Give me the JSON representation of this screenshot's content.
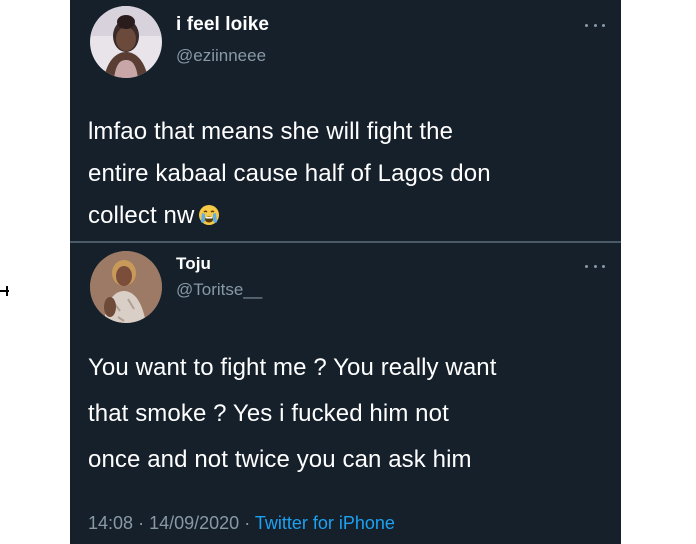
{
  "tweets": [
    {
      "display_name": "i feel loike",
      "handle": "@eziinneee",
      "text_lines": [
        "lmfao that means she will fight the",
        "entire kabaal cause half of Lagos don",
        "collect nw"
      ],
      "trailing_emoji": "crying-face-icon"
    },
    {
      "display_name": "Toju",
      "handle": "@Toritse__",
      "text_lines": [
        "You want to fight me ? You really want",
        "that smoke ? Yes i fucked him not",
        "once and not twice you can ask him"
      ],
      "time": "14:08",
      "separator": "·",
      "date": "14/09/2020",
      "source": "Twitter for iPhone"
    }
  ],
  "colors": {
    "background": "#15202b",
    "text_primary": "#ffffff",
    "text_secondary": "#8899a6",
    "link": "#1da1f2"
  }
}
